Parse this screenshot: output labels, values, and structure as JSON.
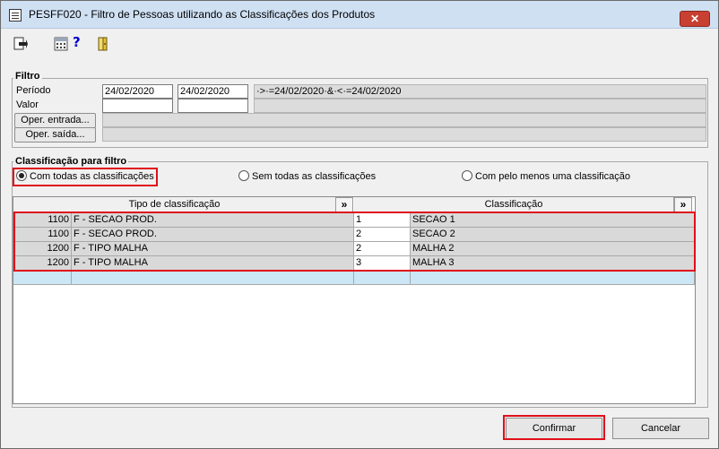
{
  "window": {
    "title": "PESFF020 - Filtro de Pessoas utilizando as Classificações dos Produtos",
    "close_glyph": "✕"
  },
  "toolbar": {
    "help_glyph": "?",
    "icons": [
      "exit-icon",
      "calculator-icon",
      "help-icon",
      "door-exit-icon"
    ]
  },
  "filtro": {
    "title": "Filtro",
    "periodo_label": "Período",
    "valor_label": "Valor",
    "date_from": "24/02/2020",
    "date_to": "24/02/2020",
    "period_expression": "·>·=24/02/2020·&·<·=24/02/2020",
    "valor_from": "",
    "valor_to": "",
    "oper_entrada_label": "Oper. entrada...",
    "oper_saida_label": "Oper. saída..."
  },
  "classificacao": {
    "title": "Classificação para filtro",
    "options": [
      {
        "label": "Com todas as classificações",
        "selected": true
      },
      {
        "label": "Sem todas as classificações",
        "selected": false
      },
      {
        "label": "Com pelo menos uma classificação",
        "selected": false
      }
    ],
    "columns": {
      "tipo": "Tipo de classificação",
      "classificacao": "Classificação",
      "expand": "»"
    },
    "rows": [
      {
        "tipo_cod": "1100",
        "tipo_desc": "F - SECAO PROD.",
        "class_cod": "1",
        "class_desc": "SECAO 1"
      },
      {
        "tipo_cod": "1100",
        "tipo_desc": "F - SECAO PROD.",
        "class_cod": "2",
        "class_desc": "SECAO 2"
      },
      {
        "tipo_cod": "1200",
        "tipo_desc": "F - TIPO MALHA",
        "class_cod": "2",
        "class_desc": "MALHA 2"
      },
      {
        "tipo_cod": "1200",
        "tipo_desc": "F - TIPO MALHA",
        "class_cod": "3",
        "class_desc": "MALHA 3"
      }
    ]
  },
  "actions": {
    "confirm_label": "Confirmar",
    "cancel_label": "Cancelar"
  },
  "colors": {
    "highlight": "#e0101a",
    "new_row": "#cbe6f5",
    "titlebar": "#cfe0f3",
    "close": "#c84031"
  }
}
